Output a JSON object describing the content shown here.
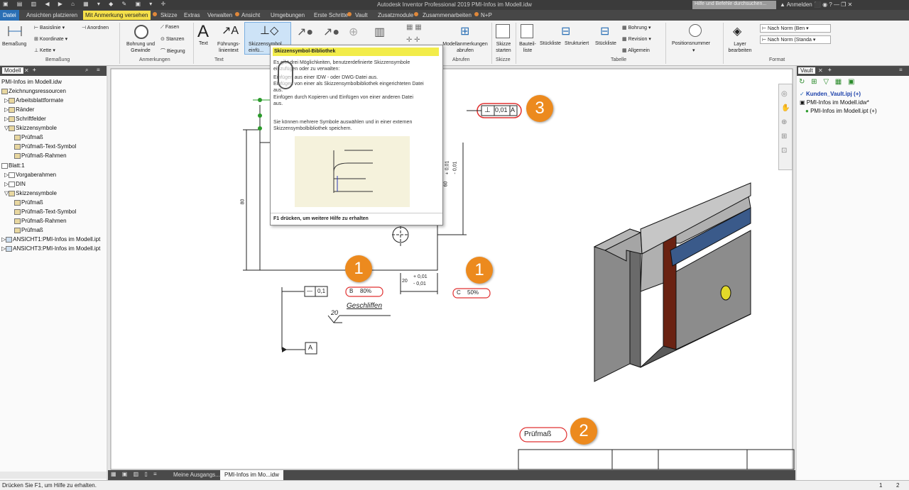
{
  "titlebar": {
    "title": "Autodesk Inventor Professional 2019   PMI-Infos im Modell.idw",
    "search_placeholder": "Hilfe und Befehle durchsuchen...",
    "login": "Anmelden"
  },
  "menu": {
    "datei": "Datei",
    "items": [
      "Ansichten platzieren",
      "Mit Anmerkung versehen",
      "Skizze",
      "Extras",
      "Verwalten",
      "Ansicht",
      "Umgebungen",
      "Erste Schritte",
      "Vault",
      "Zusatzmodule",
      "Zusammenarbeiten",
      "N+P"
    ]
  },
  "ribbon": {
    "bemassung": "Bemaßung",
    "basislinie": "Basislinie",
    "koordinate": "Koordinate",
    "kette": "Kette",
    "anordnen": "Anordnen",
    "grp_bemassung": "Bemaßung",
    "bohrung": "Bohrung und Gewinde",
    "fasen": "Fasen",
    "stanzen": "Stanzen",
    "biegung": "Biegung",
    "grp_anmerkungen": "Anmerkungen",
    "text": "Text",
    "fuehrung": "Führungs-linientext",
    "grp_text": "Text",
    "skizzensymbol": "Skizzensymbol einfü...",
    "modellanm": "Modellanmerkungen abrufen",
    "grp_abrufen": "Abrufen",
    "skizze_starten": "Skizze starten",
    "grp_skizze": "Skizze",
    "bauteilliste": "Bauteil-liste",
    "stueckliste": "Stückliste",
    "strukturiert": "Strukturiert",
    "stueckliste2": "Stückliste",
    "bohrung2": "Bohrung",
    "revision": "Revision",
    "allgemein": "Allgemein",
    "grp_tabelle": "Tabelle",
    "positionsnummer": "Positionsnummer",
    "layer": "Layer bearbeiten",
    "norm1": "Nach Norm (Ben",
    "norm2": "Nach Norm (Standa",
    "grp_format": "Format"
  },
  "left_panel": {
    "tab": "Modell",
    "file": "PMI-Infos im Modell.idw",
    "items": [
      "Zeichnungsressourcen",
      "Arbeitsblattformate",
      "Ränder",
      "Schriftfelder",
      "Skizzensymbole",
      "Prüfmaß",
      "Prüfmaß-Text-Symbol",
      "Prüfmaß-Rahmen",
      "Blatt:1",
      "Vorgaberahmen",
      "DIN",
      "Skizzensymbole",
      "Prüfmaß",
      "Prüfmaß-Text-Symbol",
      "Prüfmaß-Rahmen",
      "Prüfmaß",
      "ANSICHT1:PMI-Infos im Modell.ipt",
      "ANSICHT3:PMI-Infos im Modell.ipt"
    ]
  },
  "right_panel": {
    "tab": "Vault",
    "items": [
      "Kunden_Vault.ipj (+)",
      "PMI-Infos im Modell.idw*",
      "PMI-Infos im Modell.ipt (+)"
    ]
  },
  "tooltip": {
    "title": "Skizzensymbol-Bibliothek",
    "lines": [
      "Es gibt drei Möglichkeiten, benutzerdefinierte Skizzensymbole",
      "einzufügen oder zu verwalten:",
      "Einfügen aus einer IDW - oder DWG-Datei aus.",
      "Einfügen von einer als Skizzensymbolbibliothek eingerichteten Datei",
      "aus.",
      "Einfügen durch Kopieren und Einfügen von einer anderen Datei",
      "aus.",
      "Sie können mehrere Symbole auswählen und in einer externen",
      "Skizzensymbolbibliothek speichern."
    ],
    "footer": "F1 drücken, um weitere Hilfe zu erhalten"
  },
  "drawing": {
    "tol_box": "0,01",
    "datum_a": "A",
    "dim80": "80",
    "dim60": "60",
    "tol60a": "+ 0,01",
    "tol60b": "- 0,01",
    "dim20": "20",
    "tol20a": "+ 0,01",
    "tol20b": "- 0,01",
    "fc_val": "0,1",
    "insp_b_letter": "B",
    "insp_b": "80%",
    "insp_c_letter": "C",
    "insp_c": "50%",
    "surface": "20",
    "geschliffen": "Geschliffen",
    "datum_a2": "A",
    "pruefmass": "Prüfmaß"
  },
  "badges": [
    "1",
    "1",
    "3",
    "2"
  ],
  "tabs": {
    "t1": "Meine Ausgangs...",
    "t2": "PMI-Infos im Mo...idw"
  },
  "status": {
    "text": "Drücken Sie F1, um Hilfe zu erhalten.",
    "p1": "1",
    "p2": "2"
  },
  "colors": {
    "accent": "#f5e04a",
    "badge": "#ec8a1e",
    "highlight": "#e03030"
  }
}
